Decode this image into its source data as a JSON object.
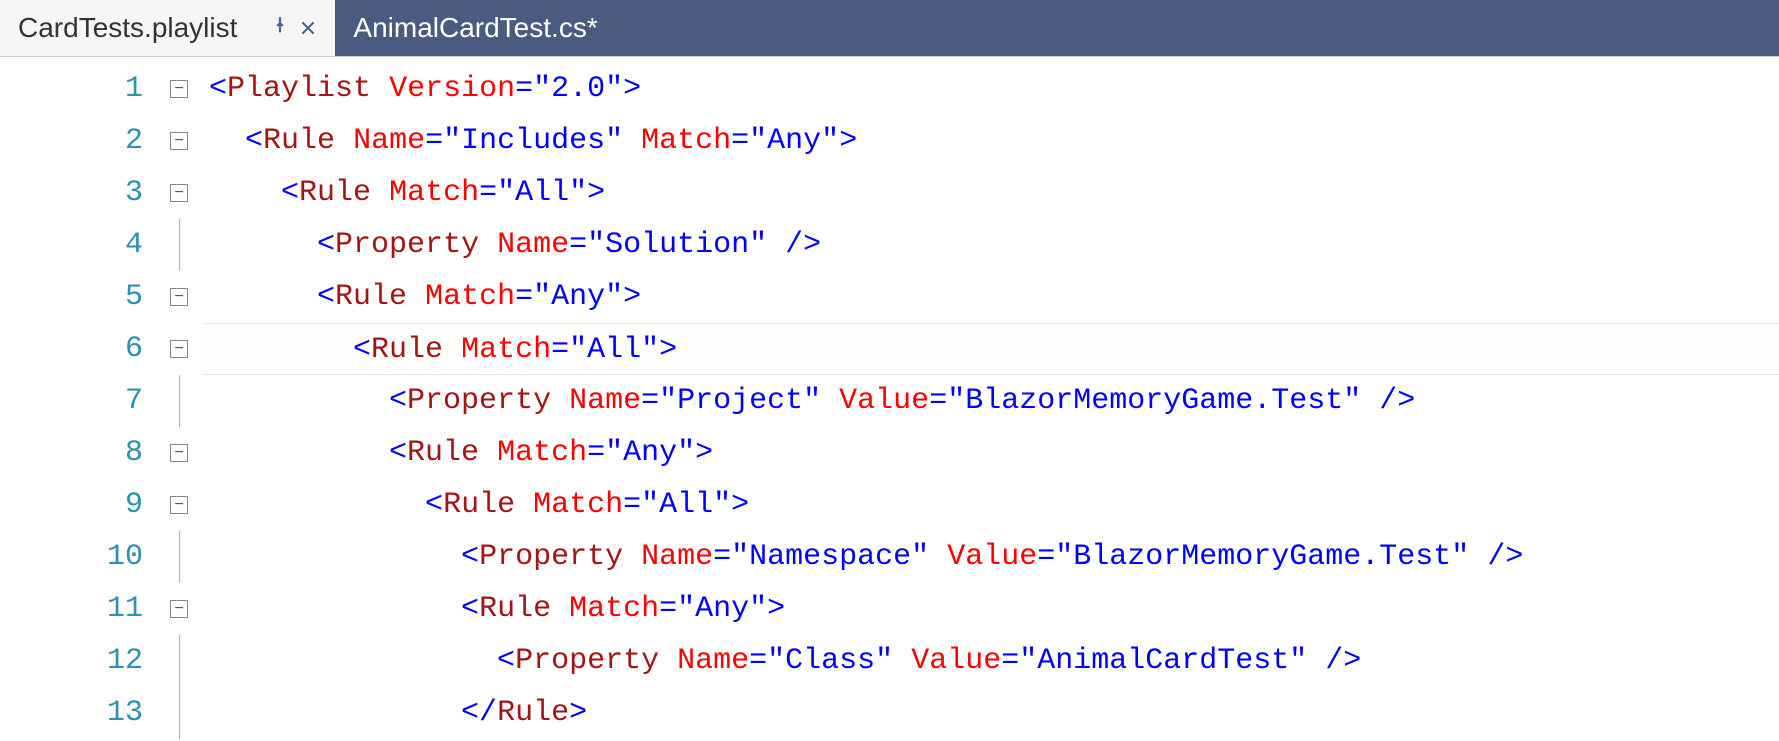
{
  "tabs": {
    "active": {
      "label": "CardTests.playlist"
    },
    "inactive": {
      "label": "AnimalCardTest.cs*"
    }
  },
  "lineNumbers": [
    "1",
    "2",
    "3",
    "4",
    "5",
    "6",
    "7",
    "8",
    "9",
    "10",
    "11",
    "12",
    "13"
  ],
  "fold": [
    "minus",
    "minus",
    "minus",
    "line",
    "minus",
    "minus",
    "line",
    "minus",
    "minus",
    "line",
    "minus",
    "line",
    "line"
  ],
  "code": [
    {
      "indent": 0,
      "hl": false,
      "tokens": [
        {
          "c": "bracket",
          "t": "<"
        },
        {
          "c": "element",
          "t": "Playlist"
        },
        {
          "c": "plain",
          "t": " "
        },
        {
          "c": "attr",
          "t": "Version"
        },
        {
          "c": "eq",
          "t": "="
        },
        {
          "c": "string",
          "t": "\"2.0\""
        },
        {
          "c": "bracket",
          "t": ">"
        }
      ]
    },
    {
      "indent": 1,
      "hl": false,
      "tokens": [
        {
          "c": "bracket",
          "t": "<"
        },
        {
          "c": "element",
          "t": "Rule"
        },
        {
          "c": "plain",
          "t": " "
        },
        {
          "c": "attr",
          "t": "Name"
        },
        {
          "c": "eq",
          "t": "="
        },
        {
          "c": "string",
          "t": "\"Includes\""
        },
        {
          "c": "plain",
          "t": " "
        },
        {
          "c": "attr",
          "t": "Match"
        },
        {
          "c": "eq",
          "t": "="
        },
        {
          "c": "string",
          "t": "\"Any\""
        },
        {
          "c": "bracket",
          "t": ">"
        }
      ]
    },
    {
      "indent": 2,
      "hl": false,
      "tokens": [
        {
          "c": "bracket",
          "t": "<"
        },
        {
          "c": "element",
          "t": "Rule"
        },
        {
          "c": "plain",
          "t": " "
        },
        {
          "c": "attr",
          "t": "Match"
        },
        {
          "c": "eq",
          "t": "="
        },
        {
          "c": "string",
          "t": "\"All\""
        },
        {
          "c": "bracket",
          "t": ">"
        }
      ]
    },
    {
      "indent": 3,
      "hl": false,
      "tokens": [
        {
          "c": "bracket",
          "t": "<"
        },
        {
          "c": "element",
          "t": "Property"
        },
        {
          "c": "plain",
          "t": " "
        },
        {
          "c": "attr",
          "t": "Name"
        },
        {
          "c": "eq",
          "t": "="
        },
        {
          "c": "string",
          "t": "\"Solution\""
        },
        {
          "c": "plain",
          "t": " "
        },
        {
          "c": "bracket",
          "t": "/>"
        }
      ]
    },
    {
      "indent": 3,
      "hl": false,
      "tokens": [
        {
          "c": "bracket",
          "t": "<"
        },
        {
          "c": "element",
          "t": "Rule"
        },
        {
          "c": "plain",
          "t": " "
        },
        {
          "c": "attr",
          "t": "Match"
        },
        {
          "c": "eq",
          "t": "="
        },
        {
          "c": "string",
          "t": "\"Any\""
        },
        {
          "c": "bracket",
          "t": ">"
        }
      ]
    },
    {
      "indent": 4,
      "hl": true,
      "tokens": [
        {
          "c": "bracket",
          "t": "<"
        },
        {
          "c": "element",
          "t": "Rule"
        },
        {
          "c": "plain",
          "t": " "
        },
        {
          "c": "attr",
          "t": "Match"
        },
        {
          "c": "eq",
          "t": "="
        },
        {
          "c": "string",
          "t": "\"All\""
        },
        {
          "c": "bracket",
          "t": ">"
        }
      ]
    },
    {
      "indent": 5,
      "hl": false,
      "tokens": [
        {
          "c": "bracket",
          "t": "<"
        },
        {
          "c": "element",
          "t": "Property"
        },
        {
          "c": "plain",
          "t": " "
        },
        {
          "c": "attr",
          "t": "Name"
        },
        {
          "c": "eq",
          "t": "="
        },
        {
          "c": "string",
          "t": "\"Project\""
        },
        {
          "c": "plain",
          "t": " "
        },
        {
          "c": "attr",
          "t": "Value"
        },
        {
          "c": "eq",
          "t": "="
        },
        {
          "c": "string",
          "t": "\"BlazorMemoryGame.Test\""
        },
        {
          "c": "plain",
          "t": " "
        },
        {
          "c": "bracket",
          "t": "/>"
        }
      ]
    },
    {
      "indent": 5,
      "hl": false,
      "tokens": [
        {
          "c": "bracket",
          "t": "<"
        },
        {
          "c": "element",
          "t": "Rule"
        },
        {
          "c": "plain",
          "t": " "
        },
        {
          "c": "attr",
          "t": "Match"
        },
        {
          "c": "eq",
          "t": "="
        },
        {
          "c": "string",
          "t": "\"Any\""
        },
        {
          "c": "bracket",
          "t": ">"
        }
      ]
    },
    {
      "indent": 6,
      "hl": false,
      "tokens": [
        {
          "c": "bracket",
          "t": "<"
        },
        {
          "c": "element",
          "t": "Rule"
        },
        {
          "c": "plain",
          "t": " "
        },
        {
          "c": "attr",
          "t": "Match"
        },
        {
          "c": "eq",
          "t": "="
        },
        {
          "c": "string",
          "t": "\"All\""
        },
        {
          "c": "bracket",
          "t": ">"
        }
      ]
    },
    {
      "indent": 7,
      "hl": false,
      "tokens": [
        {
          "c": "bracket",
          "t": "<"
        },
        {
          "c": "element",
          "t": "Property"
        },
        {
          "c": "plain",
          "t": " "
        },
        {
          "c": "attr",
          "t": "Name"
        },
        {
          "c": "eq",
          "t": "="
        },
        {
          "c": "string",
          "t": "\"Namespace\""
        },
        {
          "c": "plain",
          "t": " "
        },
        {
          "c": "attr",
          "t": "Value"
        },
        {
          "c": "eq",
          "t": "="
        },
        {
          "c": "string",
          "t": "\"BlazorMemoryGame.Test\""
        },
        {
          "c": "plain",
          "t": " "
        },
        {
          "c": "bracket",
          "t": "/>"
        }
      ]
    },
    {
      "indent": 7,
      "hl": false,
      "tokens": [
        {
          "c": "bracket",
          "t": "<"
        },
        {
          "c": "element",
          "t": "Rule"
        },
        {
          "c": "plain",
          "t": " "
        },
        {
          "c": "attr",
          "t": "Match"
        },
        {
          "c": "eq",
          "t": "="
        },
        {
          "c": "string",
          "t": "\"Any\""
        },
        {
          "c": "bracket",
          "t": ">"
        }
      ]
    },
    {
      "indent": 8,
      "hl": false,
      "tokens": [
        {
          "c": "bracket",
          "t": "<"
        },
        {
          "c": "element",
          "t": "Property"
        },
        {
          "c": "plain",
          "t": " "
        },
        {
          "c": "attr",
          "t": "Name"
        },
        {
          "c": "eq",
          "t": "="
        },
        {
          "c": "string",
          "t": "\"Class\""
        },
        {
          "c": "plain",
          "t": " "
        },
        {
          "c": "attr",
          "t": "Value"
        },
        {
          "c": "eq",
          "t": "="
        },
        {
          "c": "string",
          "t": "\"AnimalCardTest\""
        },
        {
          "c": "plain",
          "t": " "
        },
        {
          "c": "bracket",
          "t": "/>"
        }
      ]
    },
    {
      "indent": 7,
      "hl": false,
      "tokens": [
        {
          "c": "bracket",
          "t": "</"
        },
        {
          "c": "element",
          "t": "Rule"
        },
        {
          "c": "bracket",
          "t": ">"
        }
      ]
    }
  ]
}
